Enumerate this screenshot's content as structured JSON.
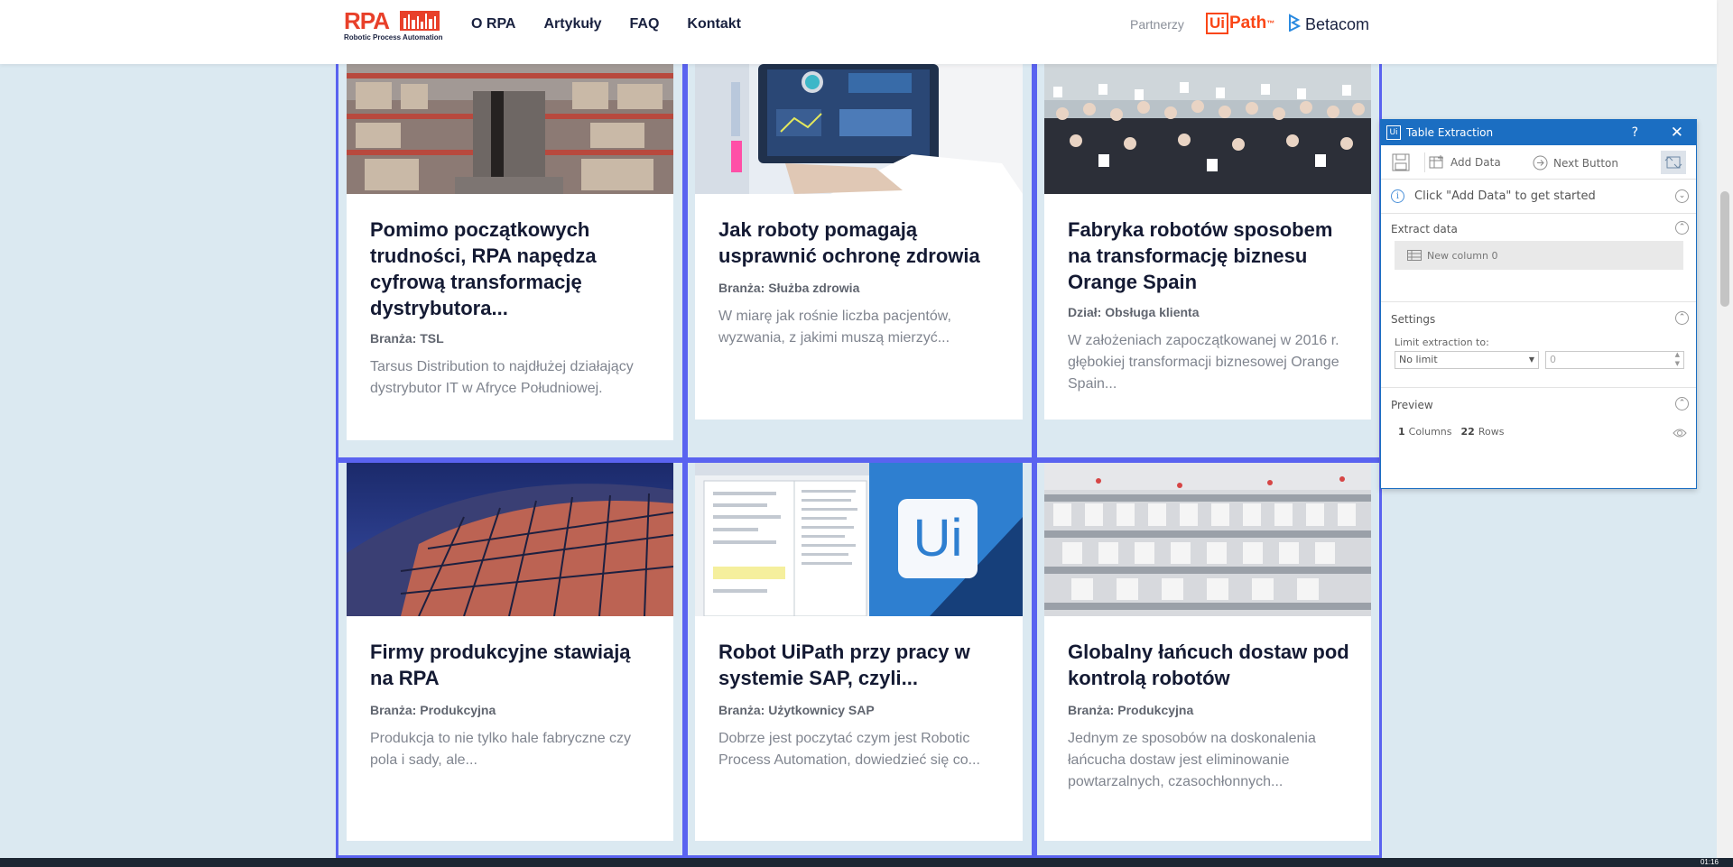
{
  "header": {
    "logo_text": "RPA",
    "logo_subtext": "Robotic Process Automation",
    "nav": [
      "O RPA",
      "Artykuły",
      "FAQ",
      "Kontakt"
    ],
    "partners_label": "Partnerzy",
    "uipath_ui": "Ui",
    "uipath_path": "Path",
    "uipath_tm": "™",
    "betacom": "Betacom"
  },
  "cards": [
    {
      "title": "Pomimo początkowych trudności, RPA napędza cyfrową transformację dystrybutora...",
      "meta": "Branża: TSL",
      "desc": "Tarsus Distribution to najdłużej działający dystrybutor IT w Afryce Południowej."
    },
    {
      "title": "Jak roboty pomagają usprawnić ochronę zdrowia",
      "meta": "Branża: Służba zdrowia",
      "desc": "W miarę jak rośnie liczba pacjentów, wyzwania, z jakimi muszą mierzyć..."
    },
    {
      "title": "Fabryka robotów sposobem na transformację biznesu Orange Spain",
      "meta": "Dział: Obsługa klienta",
      "desc": "W założeniach zapoczątkowanej w 2016 r. głębokiej transformacji biznesowej Orange Spain..."
    },
    {
      "title": "Firmy produkcyjne stawiają na RPA",
      "meta": "Branża: Produkcyjna",
      "desc": "Produkcja to nie tylko hale fabryczne czy pola i sady, ale..."
    },
    {
      "title": "Robot UiPath przy pracy w systemie SAP, czyli...",
      "meta": "Branża: Użytkownicy SAP",
      "desc": "Dobrze jest poczytać czym jest Robotic Process Automation, dowiedzieć się co..."
    },
    {
      "title": "Globalny łańcuch dostaw pod kontrolą robotów",
      "meta": "Branża: Produkcyjna",
      "desc": "Jednym ze sposobów na doskonalenia łańcucha dostaw jest eliminowanie powtarzalnych, czasochłonnych..."
    }
  ],
  "card5_logo": "Ui",
  "panel": {
    "title": "Table Extraction",
    "icon": "Ui",
    "help": "?",
    "close": "✕",
    "add_data": "Add Data",
    "next_button": "Next Button",
    "info": "Click \"Add Data\" to get started",
    "extract_header": "Extract data",
    "column_name": "New column 0",
    "settings_header": "Settings",
    "limit_label": "Limit extraction to:",
    "limit_value": "No limit",
    "limit_number": "0",
    "preview_header": "Preview",
    "columns_count": "1",
    "columns_label": "Columns",
    "rows_count": "22",
    "rows_label": "Rows"
  },
  "taskbar_time": "01:16",
  "colors": {
    "accent": "#5a63f0",
    "brand_red": "#e8402a",
    "uipath_orange": "#fa4616",
    "panel_blue": "#1b6ec2",
    "background": "#dbe9f1"
  }
}
